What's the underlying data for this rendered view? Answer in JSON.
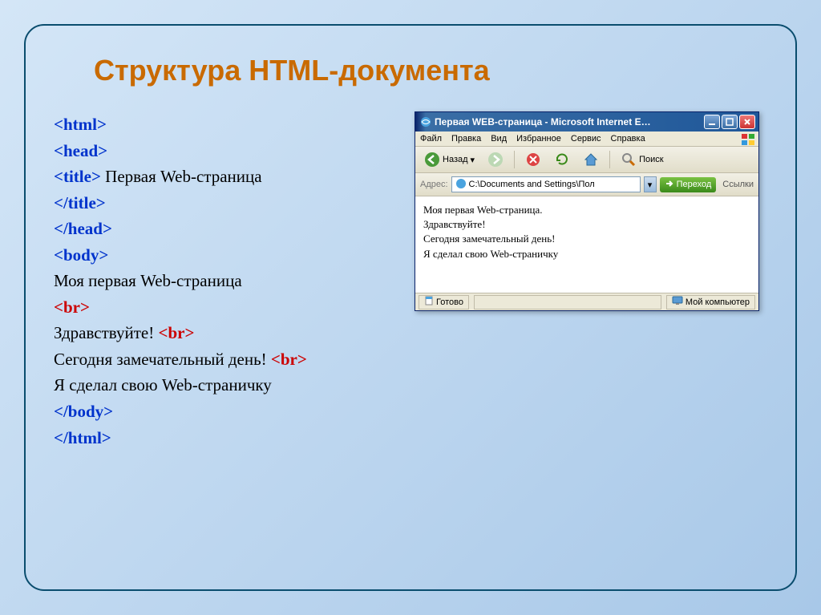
{
  "slide": {
    "title": "Структура HTML-документа"
  },
  "code": {
    "html_open": "<html>",
    "head_open": "<head>",
    "title_open": "<title>",
    "title_text": " Первая  Web-страница",
    "title_close": "</title>",
    "head_close": "</head>",
    "body_open": "<body>",
    "line1": "Моя первая Web-страница",
    "br1": "<br>",
    "line2": "Здравствуйте! ",
    "br2": "<br>",
    "line3": "Сегодня замечательный день! ",
    "br3": "<br>",
    "line4": "Я сделал свою Web-страничку",
    "body_close": "</body>",
    "html_close": "</html>"
  },
  "ie": {
    "title": "Первая WEB-страница - Microsoft Internet E…",
    "menu": {
      "file": "Файл",
      "edit": "Правка",
      "view": "Вид",
      "favorites": "Избранное",
      "tools": "Сервис",
      "help": "Справка"
    },
    "toolbar": {
      "back": "Назад",
      "search": "Поиск"
    },
    "address": {
      "label": "Адрес:",
      "value": "C:\\Documents and Settings\\Пол",
      "go": "Переход",
      "links": "Ссылки"
    },
    "page": {
      "l1": "Моя первая Web-страница.",
      "l2": "Здравствуйте!",
      "l3": "Сегодня замечательный день!",
      "l4": "Я сделал свою Web-страничку"
    },
    "status": {
      "ready": "Готово",
      "mycomputer": "Мой компьютер"
    }
  }
}
